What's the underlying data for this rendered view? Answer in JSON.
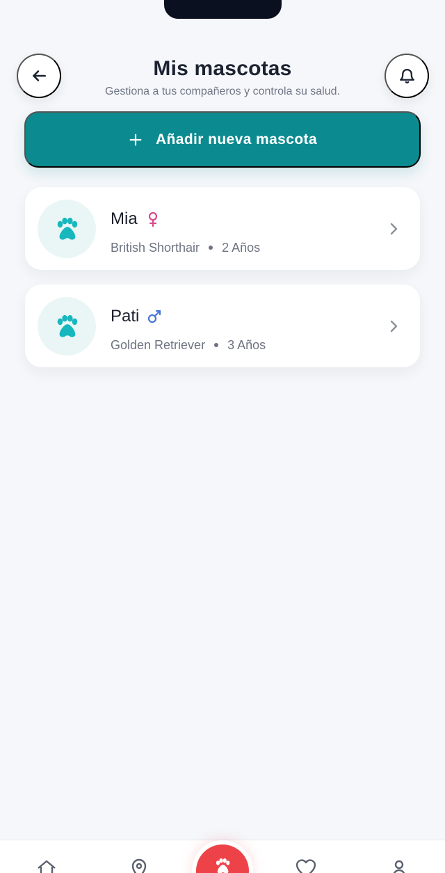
{
  "colors": {
    "background": "#f5f7fa",
    "primary": "#0b8a8f",
    "paw": "#17b7be",
    "female": "#d64b8d",
    "male": "#4777d6",
    "text": "#1c2230",
    "muted": "#6f7684",
    "danger": "#ee4249"
  },
  "header": {
    "title": "Mis mascotas",
    "subtitle": "Gestiona a tus compañeros y controla su salud.",
    "back_icon": "arrow-left-icon",
    "bell_icon": "bell-icon"
  },
  "actions": {
    "add_pet_label": "Añadir nueva mascota",
    "add_icon": "plus-icon"
  },
  "pets": [
    {
      "name": "Mia",
      "gender_icon": "female-icon",
      "breed": "British Shorthair",
      "age": "2 Años"
    },
    {
      "name": "Pati",
      "gender_icon": "male-icon",
      "breed": "Golden Retriever",
      "age": "3 Años"
    }
  ],
  "bottom_nav": {
    "items": [
      "home-icon",
      "location-icon",
      "paw-icon",
      "heart-icon",
      "profile-icon"
    ]
  }
}
